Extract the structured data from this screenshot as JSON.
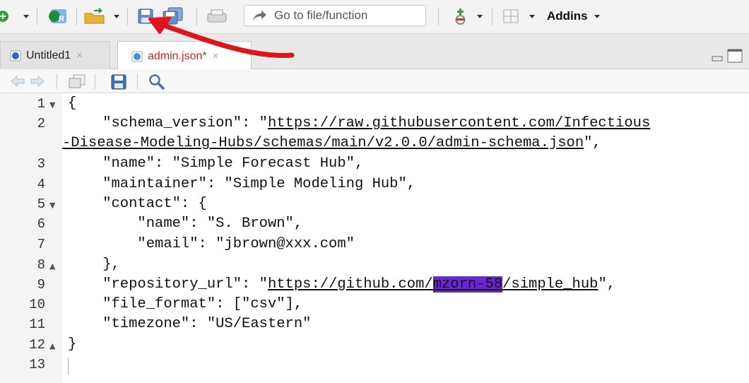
{
  "toolbar": {
    "goto_placeholder": "Go to file/function",
    "addins_label": "Addins"
  },
  "tabs": [
    {
      "label": "Untitled1",
      "close": "×",
      "active": false
    },
    {
      "label": "admin.json*",
      "close": "×",
      "active": true
    }
  ],
  "editor": {
    "line_numbers": [
      "1",
      "2",
      "",
      "3",
      "4",
      "5",
      "6",
      "7",
      "8",
      "9",
      "10",
      "11",
      "12",
      "13"
    ],
    "lines": {
      "l1": "{",
      "l2a_pre": "    \"schema_version\": \"",
      "l2a_url": "https://raw.githubusercontent.com/Infectious",
      "l2b_url": "-Disease-Modeling-Hubs/schemas/main/v2.0.0/admin-schema.json",
      "l2b_post": "\",",
      "l3": "    \"name\": \"Simple Forecast Hub\",",
      "l4": "    \"maintainer\": \"Simple Modeling Hub\",",
      "l5": "    \"contact\": {",
      "l6": "        \"name\": \"S. Brown\",",
      "l7": "        \"email\": \"jbrown@xxx.com\"",
      "l8": "    },",
      "l9_pre": "    \"repository_url\": \"",
      "l9_url_a": "https://github.com/",
      "l9_hl": "mzorn-58",
      "l9_url_b": "/simple_hub",
      "l9_post": "\",",
      "l10": "    \"file_format\": [\"csv\"],",
      "l11": "    \"timezone\": \"US/Eastern\"",
      "l12": "}"
    }
  },
  "colors": {
    "highlight": "#6a25d6",
    "annotation": "#e0141c"
  }
}
